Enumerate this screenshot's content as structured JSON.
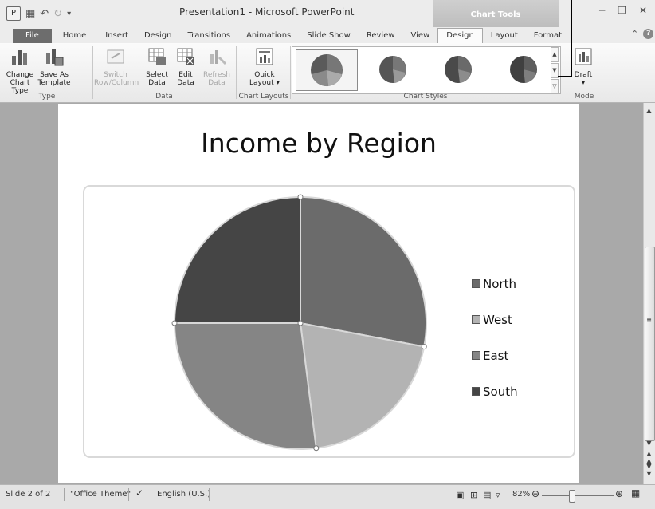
{
  "window": {
    "title": "Presentation1 - Microsoft PowerPoint",
    "context_tab_group": "Chart Tools",
    "controls": [
      "minimize-icon",
      "restore-icon",
      "close-icon"
    ]
  },
  "quick_access": {
    "app_icon_letter": "P",
    "icons": [
      "save-icon",
      "undo-icon",
      "redo-icon",
      "customize-qat-icon"
    ]
  },
  "tabs": [
    {
      "label": "File"
    },
    {
      "label": "Home"
    },
    {
      "label": "Insert"
    },
    {
      "label": "Design"
    },
    {
      "label": "Transitions"
    },
    {
      "label": "Animations"
    },
    {
      "label": "Slide Show"
    },
    {
      "label": "Review"
    },
    {
      "label": "View"
    },
    {
      "label": "Design",
      "active": true
    },
    {
      "label": "Layout"
    },
    {
      "label": "Format"
    }
  ],
  "ribbon": {
    "type_group": {
      "label": "Type",
      "change_chart_type": [
        "Change",
        "Chart Type"
      ],
      "save_as_template": [
        "Save As",
        "Template"
      ]
    },
    "data_group": {
      "label": "Data",
      "switch_row_column": [
        "Switch",
        "Row/Column"
      ],
      "select_data": [
        "Select",
        "Data"
      ],
      "edit_data": [
        "Edit",
        "Data"
      ],
      "refresh_data": [
        "Refresh",
        "Data"
      ]
    },
    "chart_layouts_group": {
      "label": "Chart Layouts",
      "quick_layout": [
        "Quick",
        "Layout ▾"
      ]
    },
    "chart_styles_group": {
      "label": "Chart Styles"
    },
    "mode_group": {
      "label": "Mode",
      "draft": "Draft"
    }
  },
  "slide": {
    "title": "Income by Region"
  },
  "chart_data": {
    "type": "pie",
    "title": "",
    "categories": [
      "North",
      "West",
      "East",
      "South"
    ],
    "values": [
      28,
      20,
      27,
      25
    ],
    "colors": [
      "#6b6b6b",
      "#b3b3b3",
      "#858585",
      "#454545"
    ],
    "legend_position": "right"
  },
  "status": {
    "slide": "Slide 2 of 2",
    "theme": "\"Office Theme\"",
    "language": "English (U.S.)",
    "zoom": "82%",
    "zoom_level_percent": 82
  }
}
